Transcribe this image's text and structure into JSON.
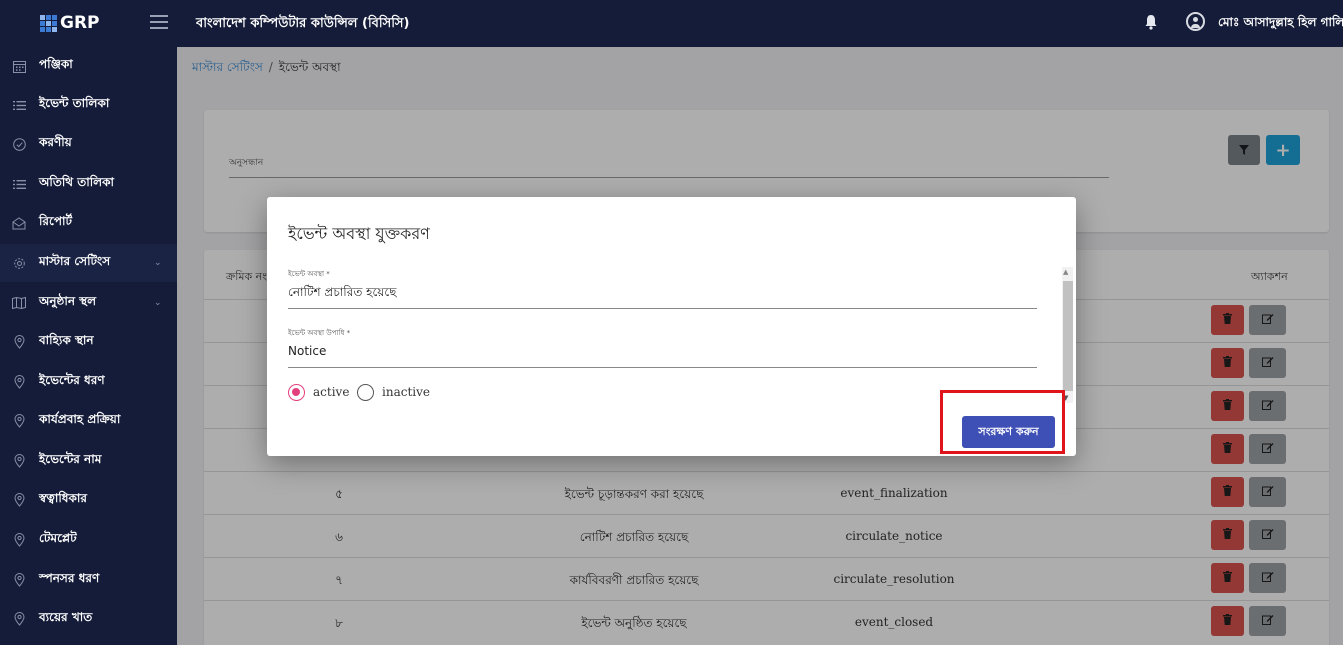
{
  "header": {
    "logo_text": "GRP",
    "app_title": "বাংলাদেশ কম্পিউটার কাউন্সিল (বিসিসি)",
    "user_name": "মোঃ আসাদুল্লাহ হিল গালিব"
  },
  "sidebar": {
    "items": [
      {
        "label": "পঞ্জিকা",
        "icon": "calendar-icon"
      },
      {
        "label": "ইভেন্ট তালিকা",
        "icon": "list-icon"
      },
      {
        "label": "করণীয়",
        "icon": "check-circle-icon"
      },
      {
        "label": "অতিথি তালিকা",
        "icon": "list-icon"
      },
      {
        "label": "রিপোর্ট",
        "icon": "report-icon"
      },
      {
        "label": "মাস্টার সেটিংস",
        "icon": "gear-icon"
      },
      {
        "label": "অনুষ্ঠান স্থল",
        "icon": "map-icon"
      },
      {
        "label": "বাহ্যিক স্থান",
        "icon": "location-pin-icon"
      },
      {
        "label": "ইভেন্টের ধরণ",
        "icon": "location-pin-icon"
      },
      {
        "label": "কার্যপ্রবাহ প্রক্রিয়া",
        "icon": "location-pin-icon"
      },
      {
        "label": "ইভেন্টের নাম",
        "icon": "location-pin-icon"
      },
      {
        "label": "স্বত্বাধিকার",
        "icon": "location-pin-icon"
      },
      {
        "label": "টেমপ্লেট",
        "icon": "location-pin-icon"
      },
      {
        "label": "স্পনসর ধরণ",
        "icon": "location-pin-icon"
      },
      {
        "label": "ব্যয়ের খাত",
        "icon": "location-pin-icon"
      }
    ]
  },
  "breadcrumb": {
    "parent": "মাস্টার সেটিংস",
    "separator": "/",
    "current": "ইভেন্ট অবস্থা"
  },
  "search": {
    "label": "অনুসন্ধান"
  },
  "table": {
    "header_serial": "ক্রমিক নং",
    "header_action": "অ্যাকশন",
    "rows": [
      {
        "serial": "৫",
        "name": "ইভেন্ট চূড়ান্তকরণ করা হয়েছে",
        "code": "event_finalization"
      },
      {
        "serial": "৬",
        "name": "নোটিশ প্রচারিত হয়েছে",
        "code": "circulate_notice"
      },
      {
        "serial": "৭",
        "name": "কার্যবিবরণী প্রচারিত হয়েছে",
        "code": "circulate_resolution"
      },
      {
        "serial": "৮",
        "name": "ইভেন্ট অনুষ্ঠিত হয়েছে",
        "code": "event_closed"
      }
    ]
  },
  "modal": {
    "title": "ইভেন্ট অবস্থা যুক্তকরণ",
    "field1_label": "ইভেন্ট অবস্থা *",
    "field1_value": "নোটিশ প্রচারিত হয়েছে",
    "field2_label": "ইভেন্ট অবস্থা উপাধি *",
    "field2_value": "Notice",
    "radio_active": "active",
    "radio_inactive": "inactive",
    "selected_status": "active",
    "save_label": "সংরক্ষণ করুন"
  },
  "colors": {
    "nav_bg": "#151c39",
    "primary_button": "#3e4fb5",
    "add_button": "#1ea1d8",
    "delete_button": "#d9534f",
    "edit_button": "#9ea2a6",
    "radio_accent": "#e2407d",
    "highlight_border": "#e0141b"
  }
}
